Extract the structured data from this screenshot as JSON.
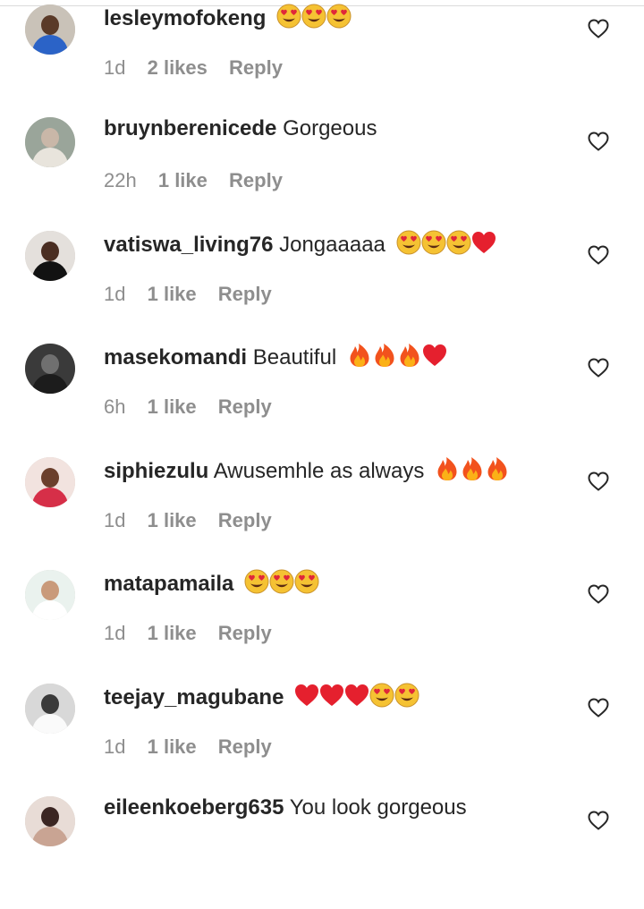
{
  "comments": [
    {
      "username": "lesleymofokeng",
      "text": "",
      "emojis": [
        "heart-eyes",
        "heart-eyes",
        "heart-eyes"
      ],
      "time": "1d",
      "likes": "2 likes",
      "reply": "Reply",
      "avatar": {
        "bg": "#c9c2b8",
        "head": "#5a3a28",
        "body": "#2b63c7"
      }
    },
    {
      "username": "bruynberenicede",
      "text": "Gorgeous",
      "emojis": [],
      "time": "22h",
      "likes": "1 like",
      "reply": "Reply",
      "avatar": {
        "bg": "#9aa59a",
        "head": "#c9b7a8",
        "body": "#e8e4dc"
      }
    },
    {
      "username": "vatiswa_living76",
      "text": "Jongaaaaa",
      "emojis": [
        "heart-eyes",
        "heart-eyes",
        "heart-eyes",
        "red-heart"
      ],
      "time": "1d",
      "likes": "1 like",
      "reply": "Reply",
      "avatar": {
        "bg": "#e4e0dc",
        "head": "#4a2e22",
        "body": "#121212"
      }
    },
    {
      "username": "masekomandi",
      "text": "Beautiful",
      "emojis": [
        "fire",
        "fire",
        "fire",
        "red-heart"
      ],
      "time": "6h",
      "likes": "1 like",
      "reply": "Reply",
      "avatar": {
        "bg": "#3a3a3a",
        "head": "#707070",
        "body": "#1c1c1c"
      }
    },
    {
      "username": "siphiezulu",
      "text": "Awusemhle as always",
      "emojis": [
        "fire",
        "fire",
        "fire"
      ],
      "time": "1d",
      "likes": "1 like",
      "reply": "Reply",
      "avatar": {
        "bg": "#f2e3df",
        "head": "#6b3f2c",
        "body": "#d62f48"
      }
    },
    {
      "username": "matapamaila",
      "text": "",
      "emojis": [
        "heart-eyes",
        "heart-eyes",
        "heart-eyes"
      ],
      "time": "1d",
      "likes": "1 like",
      "reply": "Reply",
      "avatar": {
        "bg": "#eaf2ee",
        "head": "#c99a7a",
        "body": "#ffffff"
      }
    },
    {
      "username": "teejay_magubane",
      "text": "",
      "emojis": [
        "red-heart",
        "red-heart",
        "red-heart",
        "heart-eyes",
        "heart-eyes"
      ],
      "time": "1d",
      "likes": "1 like",
      "reply": "Reply",
      "avatar": {
        "bg": "#d8d8d8",
        "head": "#3a3a3a",
        "body": "#fafafa"
      }
    },
    {
      "username": "eileenkoeberg635",
      "text": "You look gorgeous",
      "emojis": [],
      "time": "",
      "likes": "",
      "reply": "",
      "avatar": {
        "bg": "#e8dcd6",
        "head": "#3b2622",
        "body": "#c9a493"
      }
    }
  ],
  "colors": {
    "username": "#262626",
    "meta": "#8e8e8e",
    "heart_outline": "#262626"
  },
  "icons": {
    "like": "heart-outline-icon"
  }
}
